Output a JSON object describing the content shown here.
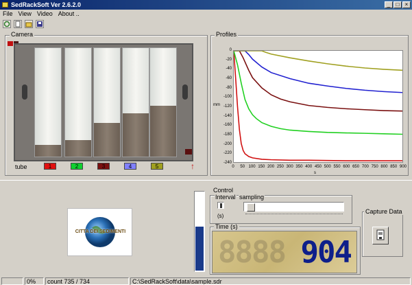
{
  "window": {
    "title": "SedRackSoft Ver 2.6.2.0"
  },
  "menu": [
    "File",
    "View",
    "Video",
    "About .."
  ],
  "camera": {
    "label": "Camera",
    "tube_label": "tube",
    "tubes": [
      {
        "label": "1",
        "color": "#e01010",
        "sediment_fraction": 0.11
      },
      {
        "label": "2",
        "color": "#10d030",
        "sediment_fraction": 0.15
      },
      {
        "label": "3",
        "color": "#7a1010",
        "sediment_fraction": 0.31
      },
      {
        "label": "4",
        "color": "#8080ff",
        "sediment_fraction": 0.4
      },
      {
        "label": "5",
        "color": "#a0a020",
        "sediment_fraction": 0.47
      }
    ]
  },
  "profiles": {
    "label": "Profiles"
  },
  "chart_data": {
    "type": "line",
    "title": "",
    "xlabel": "s",
    "ylabel": "mm",
    "xlim": [
      0,
      900
    ],
    "ylim": [
      -240,
      0
    ],
    "x_ticks": [
      "0",
      "50",
      "100",
      "150",
      "200",
      "250",
      "300",
      "350",
      "400",
      "450",
      "500",
      "550",
      "600",
      "650",
      "700",
      "750",
      "800",
      "850",
      "900"
    ],
    "y_ticks": [
      "0",
      "-20",
      "-40",
      "-60",
      "-80",
      "-100",
      "-120",
      "-140",
      "-160",
      "-180",
      "-200",
      "-220",
      "-240"
    ],
    "grid": false,
    "series": [
      {
        "color": "#d01010",
        "x": [
          0,
          10,
          20,
          30,
          40,
          50,
          60,
          80,
          100,
          150,
          200,
          300,
          400,
          600,
          900
        ],
        "y": [
          0,
          -60,
          -120,
          -170,
          -200,
          -215,
          -222,
          -228,
          -231,
          -234,
          -235,
          -236,
          -236,
          -237,
          -237
        ]
      },
      {
        "color": "#20d020",
        "x": [
          0,
          20,
          40,
          60,
          80,
          100,
          120,
          150,
          200,
          250,
          300,
          400,
          500,
          600,
          700,
          800,
          900
        ],
        "y": [
          0,
          -30,
          -70,
          -105,
          -125,
          -138,
          -146,
          -155,
          -163,
          -168,
          -171,
          -174,
          -176,
          -177,
          -178,
          -179,
          -180
        ]
      },
      {
        "color": "#7a1010",
        "x": [
          0,
          30,
          50,
          80,
          100,
          150,
          200,
          250,
          300,
          400,
          500,
          600,
          700,
          800,
          900
        ],
        "y": [
          0,
          0,
          -15,
          -42,
          -58,
          -80,
          -95,
          -104,
          -110,
          -118,
          -122,
          -125,
          -127,
          -129,
          -130
        ]
      },
      {
        "color": "#2020d0",
        "x": [
          0,
          60,
          80,
          100,
          150,
          200,
          300,
          400,
          500,
          600,
          700,
          800,
          900
        ],
        "y": [
          0,
          0,
          -8,
          -18,
          -35,
          -47,
          -60,
          -70,
          -76,
          -81,
          -85,
          -88,
          -90
        ]
      },
      {
        "color": "#a0a020",
        "x": [
          0,
          150,
          170,
          200,
          300,
          400,
          500,
          600,
          700,
          800,
          900
        ],
        "y": [
          0,
          0,
          -3,
          -7,
          -15,
          -22,
          -28,
          -33,
          -37,
          -40,
          -42
        ]
      }
    ]
  },
  "control": {
    "label": "Control",
    "interval_label": "Interval",
    "sampling_label": "sampling",
    "unit_label": "(s)",
    "capture_label": "Capture Data",
    "time_label": "Time (s)",
    "time_value": "904",
    "time_ghost": "8888",
    "progress_fraction": 0.55
  },
  "logo": {
    "text": "CITTA DEI SEDIMENTI"
  },
  "status": {
    "percent": "0%",
    "count": "count 735 / 734",
    "path": "C:\\SedRackSoft\\data\\sample.sdr"
  }
}
